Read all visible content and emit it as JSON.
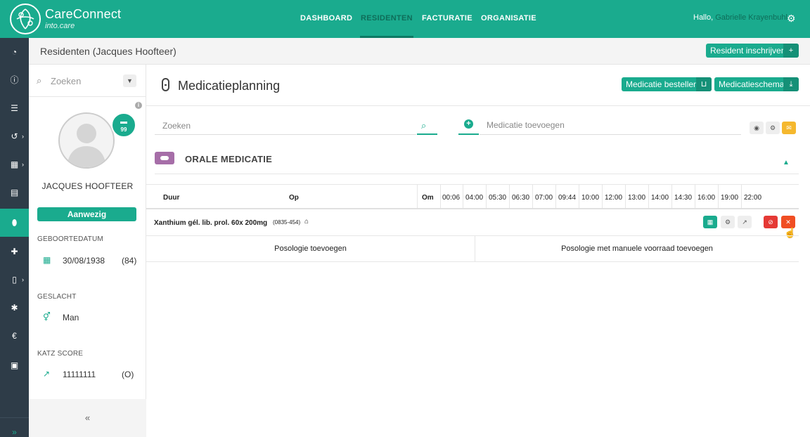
{
  "app": {
    "name": "CareConnect",
    "subtitle": "into.care"
  },
  "nav": {
    "items": [
      "DASHBOARD",
      "RESIDENTEN",
      "FACTURATIE",
      "ORGANISATIE"
    ],
    "active": "RESIDENTEN",
    "greeting": "Hallo,",
    "user": "Gabrielle Krayenbuhl"
  },
  "subheader": {
    "title": "Residenten (Jacques Hoofteer)",
    "enroll_button": "Resident inschrijven"
  },
  "resident": {
    "search_placeholder": "Zoeken",
    "bed_number": "99",
    "name": "JACQUES HOOFTEER",
    "status": "Aanwezig",
    "birthdate_label": "GEBOORTEDATUM",
    "birthdate": "30/08/1938",
    "age": "(84)",
    "gender_label": "GESLACHT",
    "gender": "Man",
    "katz_label": "KATZ SCORE",
    "katz": "11111111",
    "katz_class": "(O)",
    "collapse": "«"
  },
  "main": {
    "title": "Medicatieplanning",
    "order_button": "Medicatie bestellen",
    "schedule_button": "Medicatieschema",
    "search_placeholder": "Zoeken",
    "add_placeholder": "Medicatie toevoegen",
    "category": "ORALE MEDICATIE",
    "columns": {
      "duration": "Duur",
      "on": "Op",
      "every": "Om"
    },
    "times": [
      "00:06",
      "04:00",
      "05:30",
      "06:30",
      "07:00",
      "09:44",
      "10:00",
      "12:00",
      "13:00",
      "14:00",
      "14:30",
      "16:00",
      "19:00",
      "22:00"
    ],
    "medication": {
      "name": "Xanthium gél. lib. prol. 60x 200mg",
      "code": "(0835-454)"
    },
    "add_posology": "Posologie toevoegen",
    "add_posology_manual": "Posologie met manuele voorraad toevoegen"
  },
  "colors": {
    "accent": "#1aab8e",
    "sidebar": "#2e3c48",
    "danger": "#e53935",
    "warning": "#f5b82e",
    "category": "#a66ea8"
  }
}
